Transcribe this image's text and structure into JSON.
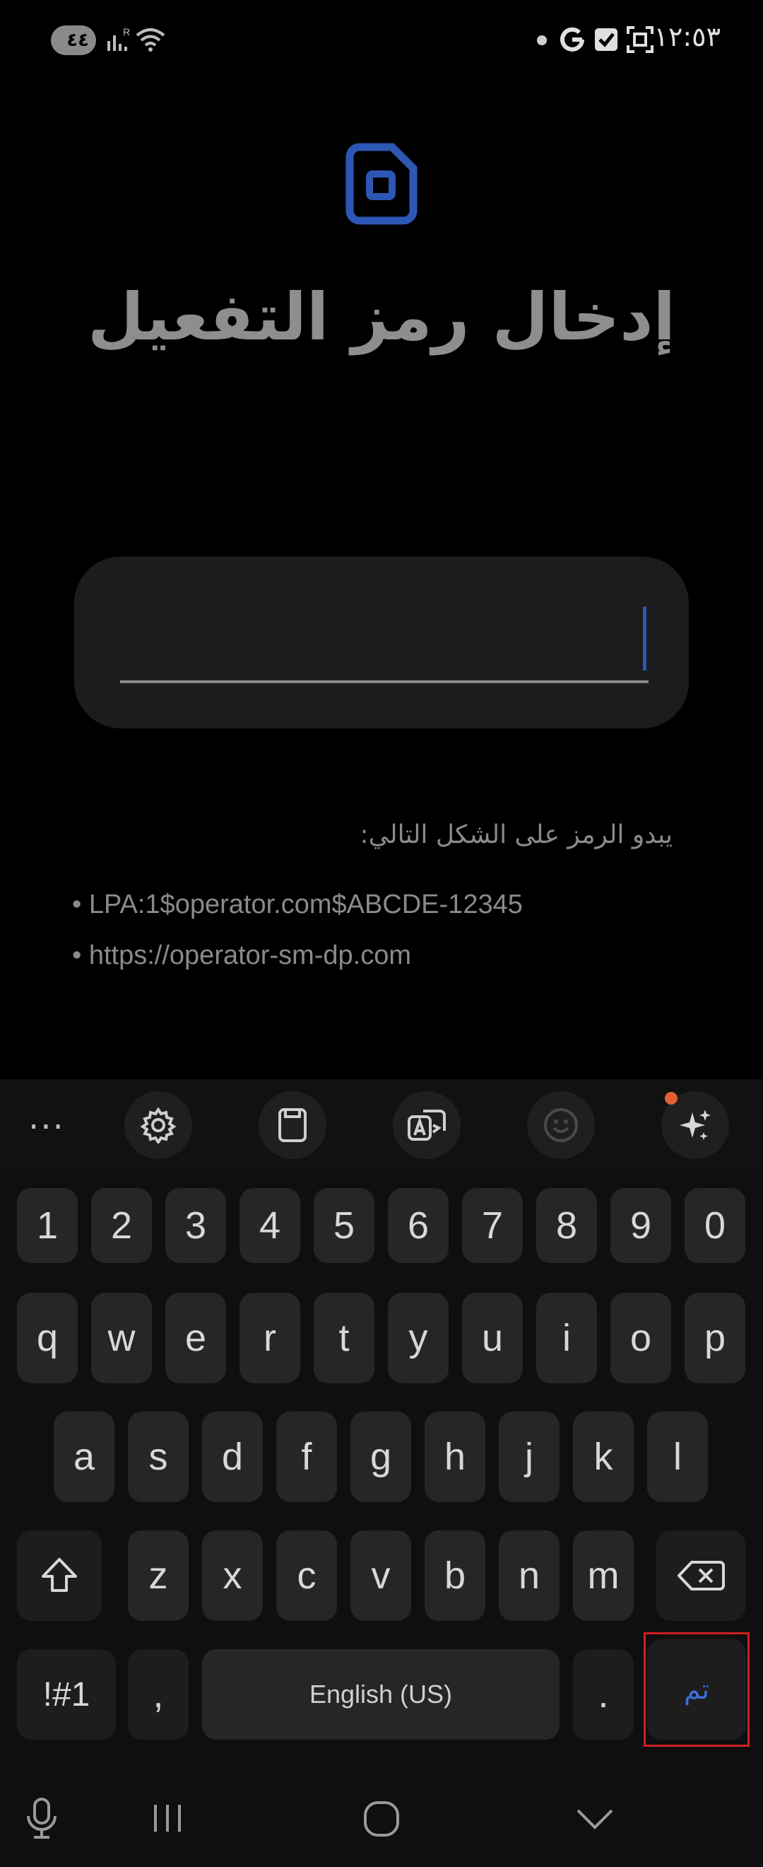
{
  "status_bar": {
    "pill_text": "٤٤",
    "time": "١٢:٥٣"
  },
  "header": {
    "icon": "sim-card-icon",
    "title": "إدخال رمز التفعيل"
  },
  "input": {
    "value": "",
    "accent": "#2d57b5"
  },
  "hint": {
    "label": "يبدو الرمز على الشكل التالي:",
    "examples": [
      "• LPA:1$operator.com$ABCDE-12345",
      "• https://operator-sm-dp.com"
    ]
  },
  "keyboard": {
    "toolbar": [
      "more-icon",
      "settings-icon",
      "clipboard-icon",
      "translate-icon",
      "emoji-icon",
      "ai-sparkle-icon"
    ],
    "row_numbers": [
      "1",
      "2",
      "3",
      "4",
      "5",
      "6",
      "7",
      "8",
      "9",
      "0"
    ],
    "row1": [
      "q",
      "w",
      "e",
      "r",
      "t",
      "y",
      "u",
      "i",
      "o",
      "p"
    ],
    "row2": [
      "a",
      "s",
      "d",
      "f",
      "g",
      "h",
      "j",
      "k",
      "l"
    ],
    "row3": [
      "z",
      "x",
      "c",
      "v",
      "b",
      "n",
      "m"
    ],
    "symbols_label": "!#1",
    "comma_label": ",",
    "space_label": "English (US)",
    "period_label": ".",
    "done_label": "تم",
    "highlight_color": "#d01f1f"
  },
  "nav": [
    "mic-icon",
    "recents-icon",
    "home-icon",
    "hide-keyboard-icon"
  ]
}
